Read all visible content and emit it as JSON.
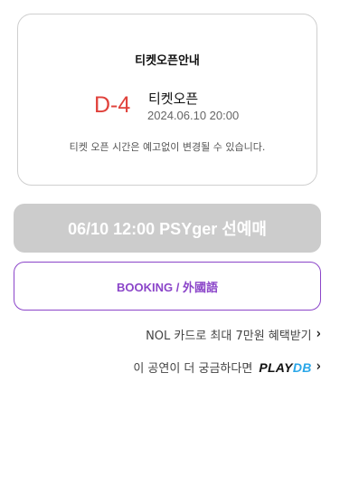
{
  "ticket_info": {
    "title": "티켓오픈안내",
    "countdown": "D-4",
    "open_label": "티켓오픈",
    "open_datetime": "2024.06.10 20:00",
    "notice": "티켓 오픈 시간은 예고없이 변경될 수 있습니다."
  },
  "buttons": {
    "presale": "06/10 12:00 PSYger 선예매",
    "booking": "BOOKING / 外國語"
  },
  "links": {
    "nol_card": "NOL 카드로 최대 7만원 혜택받기",
    "playdb_prefix": "이 공연이 더 궁금하다면",
    "playdb_logo_play": "PLAY",
    "playdb_logo_db": "DB"
  },
  "icons": {
    "chevron": "chevron-right-icon"
  },
  "colors": {
    "countdown": "#e0413b",
    "booking_accent": "#8b45c9",
    "presale_disabled": "#cccccc",
    "playdb_db": "#2aa7e8"
  }
}
